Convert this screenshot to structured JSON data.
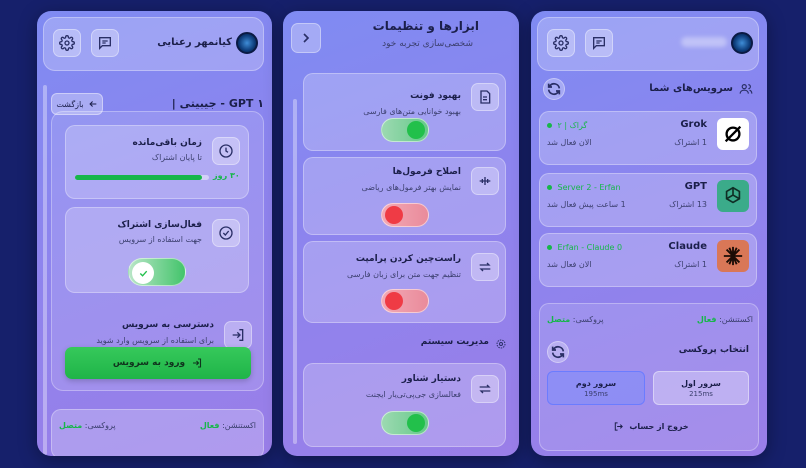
{
  "panel_left": {
    "user_name": "کیانمهر رعنایی",
    "title": "GPT - جیبیتی |",
    "title_num": "۱",
    "back_label": "بازگشت",
    "time_card": {
      "title": "زمان باقی‌مانده",
      "subtitle": "تا پایان اشتراک",
      "days_value": "۳۰",
      "days_unit": "روز",
      "progress": 0.95
    },
    "activate_card": {
      "title": "فعال‌سازی اشتراک",
      "subtitle": "جهت استفاده از سرویس",
      "toggle_on": true
    },
    "access_card": {
      "title": "دسترسی به سرویس",
      "subtitle": "برای استفاده از سرویس وارد شوید",
      "button_label": "ورود به سرویس"
    },
    "status": {
      "connection_label": "اکستنشن:",
      "connection_value": "فعال",
      "proxy_label": "پروکسی:",
      "proxy_value": "متصل"
    }
  },
  "panel_middle": {
    "title": "ابزارها و تنظیمات",
    "subtitle": "شخصی‌سازی تجربه خود",
    "items": [
      {
        "title": "بهبود فونت",
        "subtitle": "بهبود خوانایی متن‌های فارسی",
        "on": true
      },
      {
        "title": "اصلاح فرمول‌ها",
        "subtitle": "نمایش بهتر فرمول‌های ریاضی",
        "on": false
      },
      {
        "title": "راست‌چین کردن پرامپت",
        "subtitle": "تنظیم جهت متن برای زبان فارسی",
        "on": false
      }
    ],
    "section_title": "مدیریت سیستم",
    "system_item": {
      "title": "دستیار شناور",
      "subtitle": "فعالسازی جی‌پی‌تی‌یار ایجنت",
      "on": true
    }
  },
  "panel_right": {
    "section_title": "سرویس‌های شما",
    "services": [
      {
        "name": "Grok",
        "count": "1 اشتراک",
        "server": "گراک | ۲",
        "time": "الان فعال شد"
      },
      {
        "name": "GPT",
        "count": "13 اشتراک",
        "server": "Server 2 - Erfan",
        "time": "1 ساعت پیش فعال شد"
      },
      {
        "name": "Claude",
        "count": "1 اشتراک",
        "server": "Erfan - Claude 0",
        "time": "الان فعال شد"
      }
    ],
    "status": {
      "connection_label": "اکستنشن:",
      "connection_value": "فعال",
      "proxy_label": "پروکسی:",
      "proxy_value": "متصل"
    },
    "proxy_title": "انتخاب پروکسی",
    "proxies": [
      {
        "name": "سرور اول",
        "ping": "215ms"
      },
      {
        "name": "سرور دوم",
        "ping": "195ms"
      }
    ],
    "logout_label": "خروج از حساب"
  },
  "colors": {
    "accent_green": "#17b64a",
    "toggle_off_red": "#ef3b45",
    "background": "#16206b"
  }
}
